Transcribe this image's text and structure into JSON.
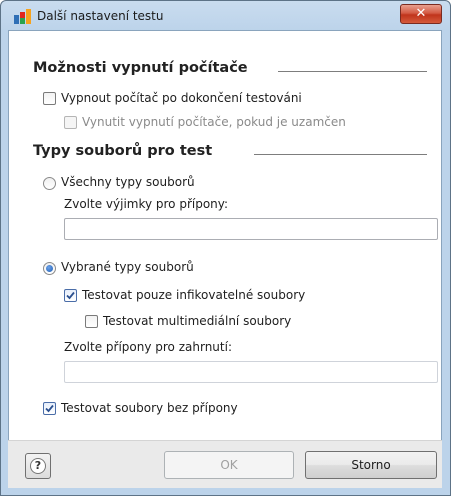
{
  "window": {
    "title": "Další nastavení testu",
    "close_glyph": "✕",
    "accent_color": "#c0341c"
  },
  "shutdown": {
    "heading": "Možnosti vypnutí počítače",
    "shutdown_after_label": "Vypnout počítač po dokončení testováni",
    "shutdown_after_checked": false,
    "force_shutdown_label": "Vynutit vypnutí počítače, pokud je uzamčen",
    "force_shutdown_checked": false,
    "force_shutdown_enabled": false
  },
  "filetypes": {
    "heading": "Typy souborů pro test",
    "all_types_label": "Všechny typy souborů",
    "all_types_selected": false,
    "exclusions_label": "Zvolte výjimky pro přípony:",
    "exclusions_value": "",
    "selected_types_label": "Vybrané typy souborů",
    "selected_types_selected": true,
    "infectable_only_label": "Testovat pouze infikovatelné soubory",
    "infectable_only_checked": true,
    "multimedia_label": "Testovat multimediální soubory",
    "multimedia_checked": false,
    "inclusions_label": "Zvolte přípony pro zahrnutí:",
    "inclusions_value": "",
    "no_extension_label": "Testovat soubory bez přípony",
    "no_extension_checked": true
  },
  "buttons": {
    "help_glyph": "?",
    "ok_label": "OK",
    "ok_enabled": false,
    "cancel_label": "Storno"
  }
}
